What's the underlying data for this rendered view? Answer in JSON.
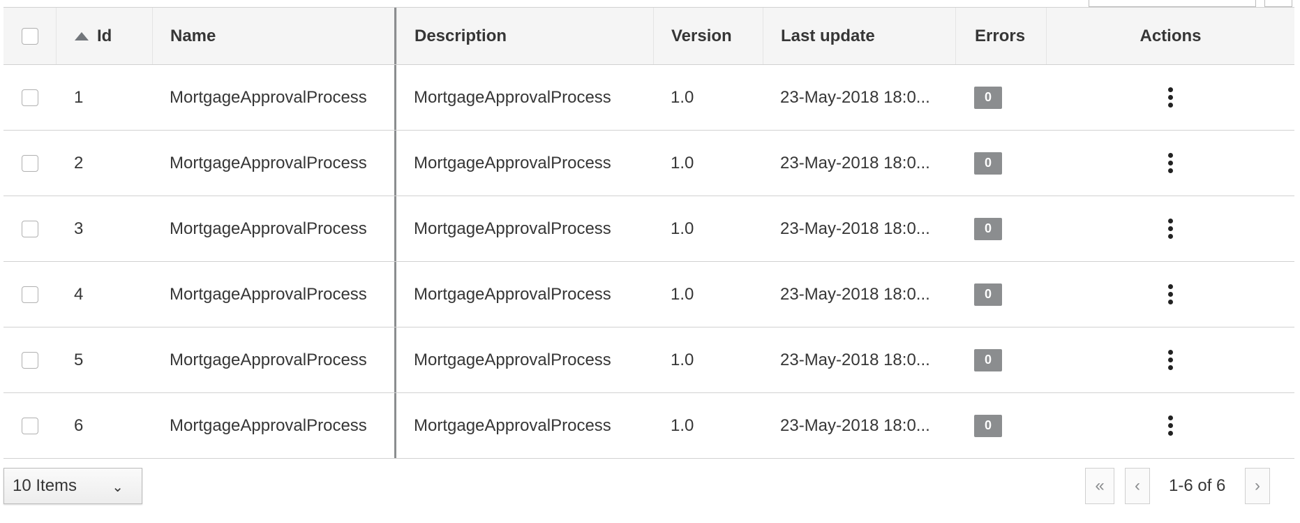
{
  "columns": {
    "id": "Id",
    "name": "Name",
    "description": "Description",
    "version": "Version",
    "last_update": "Last update",
    "errors": "Errors",
    "actions": "Actions"
  },
  "rows": [
    {
      "id": "1",
      "name": "MortgageApprovalProcess",
      "description": "MortgageApprovalProcess",
      "version": "1.0",
      "last_update": "23-May-2018 18:0...",
      "errors": "0"
    },
    {
      "id": "2",
      "name": "MortgageApprovalProcess",
      "description": "MortgageApprovalProcess",
      "version": "1.0",
      "last_update": "23-May-2018 18:0...",
      "errors": "0"
    },
    {
      "id": "3",
      "name": "MortgageApprovalProcess",
      "description": "MortgageApprovalProcess",
      "version": "1.0",
      "last_update": "23-May-2018 18:0...",
      "errors": "0"
    },
    {
      "id": "4",
      "name": "MortgageApprovalProcess",
      "description": "MortgageApprovalProcess",
      "version": "1.0",
      "last_update": "23-May-2018 18:0...",
      "errors": "0"
    },
    {
      "id": "5",
      "name": "MortgageApprovalProcess",
      "description": "MortgageApprovalProcess",
      "version": "1.0",
      "last_update": "23-May-2018 18:0...",
      "errors": "0"
    },
    {
      "id": "6",
      "name": "MortgageApprovalProcess",
      "description": "MortgageApprovalProcess",
      "version": "1.0",
      "last_update": "23-May-2018 18:0...",
      "errors": "0"
    }
  ],
  "footer": {
    "per_page": "10 Items",
    "first_icon": "«",
    "prev_icon": "‹",
    "page_range": "1-6 of 6",
    "next_icon": "›"
  },
  "icons": {
    "sort": "sort-ascending-icon",
    "actions": "kebab-menu-icon",
    "dropdown": "chevron-down-icon"
  }
}
